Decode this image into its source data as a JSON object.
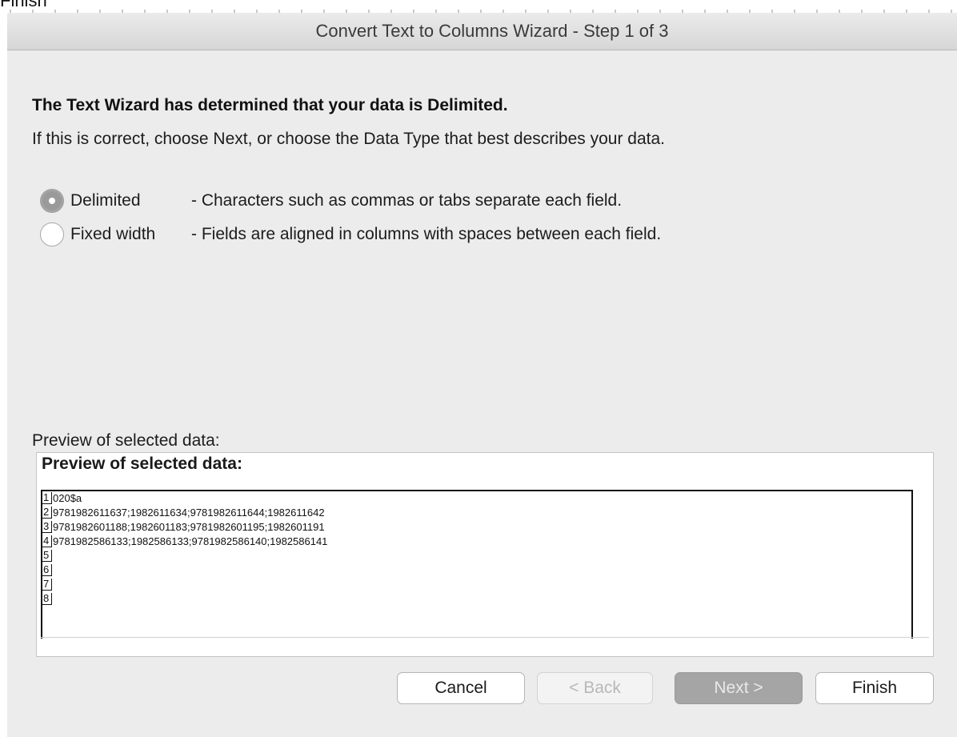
{
  "top_fragment": {
    "text": "Finish"
  },
  "window": {
    "title": "Convert Text to Columns Wizard - Step 1 of 3"
  },
  "intro": {
    "heading": "The Text Wizard has determined that your data is Delimited.",
    "subtext": "If this is correct, choose Next, or choose the Data Type that best describes your data."
  },
  "data_type": {
    "selected": "Delimited",
    "options": [
      {
        "label": "Delimited",
        "description": "- Characters such as commas or tabs separate each field.",
        "selected": true
      },
      {
        "label": "Fixed width",
        "description": "- Fields are aligned in columns with spaces between each field.",
        "selected": false
      }
    ]
  },
  "preview": {
    "label": "Preview of selected data:",
    "panel_title": "Preview of selected data:",
    "lines": [
      {
        "num": "1",
        "text": "020$a"
      },
      {
        "num": "2",
        "text": "9781982611637;1982611634;9781982611644;1982611642"
      },
      {
        "num": "3",
        "text": "9781982601188;1982601183;9781982601195;1982601191"
      },
      {
        "num": "4",
        "text": "9781982586133;1982586133;9781982586140;1982586141"
      },
      {
        "num": "5",
        "text": ""
      },
      {
        "num": "6",
        "text": ""
      },
      {
        "num": "7",
        "text": ""
      },
      {
        "num": "8",
        "text": ""
      }
    ]
  },
  "buttons": {
    "cancel": "Cancel",
    "back": "< Back",
    "next": "Next >",
    "finish": "Finish"
  }
}
